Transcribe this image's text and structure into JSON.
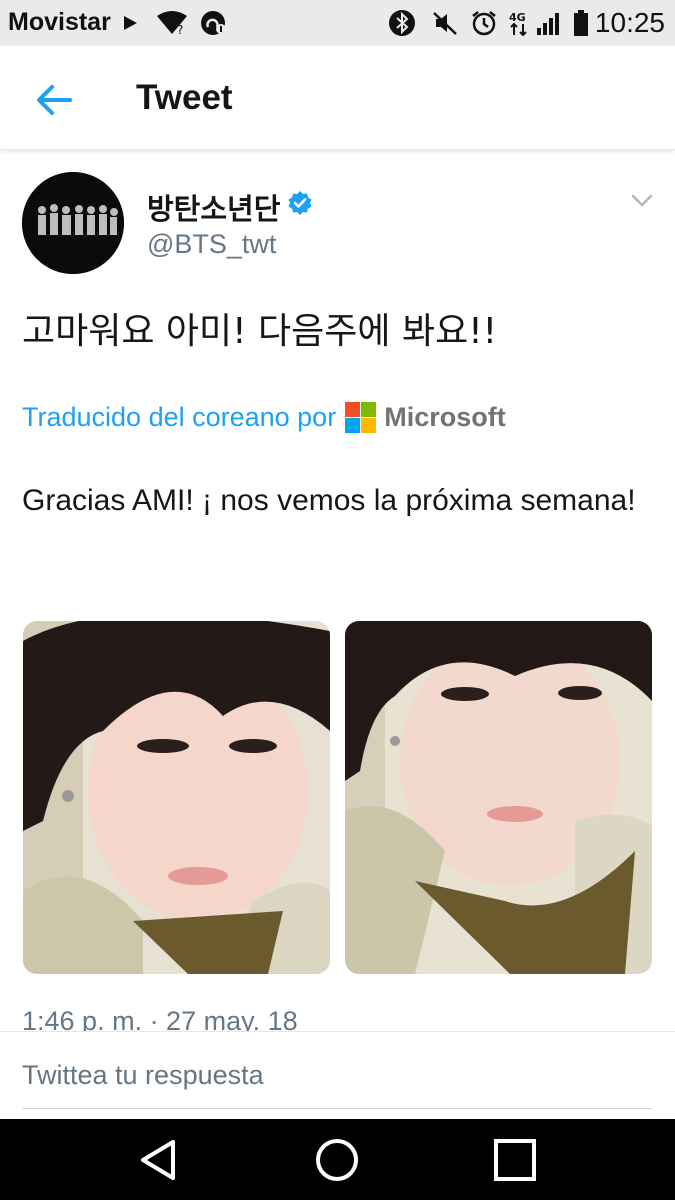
{
  "status_bar": {
    "carrier": "Movistar",
    "time": "10:25",
    "network_label": "4G",
    "icons": [
      "play-icon",
      "wifi-question-icon",
      "notification-icon",
      "bluetooth-icon",
      "mute-icon",
      "alarm-icon",
      "data-4g-icon",
      "signal-icon",
      "battery-icon"
    ]
  },
  "app_bar": {
    "title": "Tweet",
    "back_icon": "arrow-left-icon"
  },
  "tweet": {
    "author": {
      "display_name": "방탄소년단",
      "handle": "@BTS_twt",
      "verified": true
    },
    "text": "고마워요 아미! 다음주에 봐요!!",
    "translated_by": "Traducido del coreano por",
    "translator_name": "Microsoft",
    "translation": "Gracias AMI! ¡ nos vemos la próxima semana!",
    "timestamp": "1:46 p. m. · 27 may. 18",
    "photos": [
      "photo-1",
      "photo-2"
    ]
  },
  "reply": {
    "placeholder": "Twittea tu respuesta"
  },
  "nav_bar": {
    "buttons": [
      "back-triangle-icon",
      "home-circle-icon",
      "recents-square-icon"
    ]
  },
  "colors": {
    "accent": "#1da1f2",
    "text_primary": "#14171a",
    "text_secondary": "#657786",
    "status_bar_bg": "#eaeaea",
    "nav_bar_bg": "#000000",
    "ms_red": "#f25022",
    "ms_green": "#7fba00",
    "ms_blue": "#00a4ef",
    "ms_yellow": "#ffb900"
  }
}
